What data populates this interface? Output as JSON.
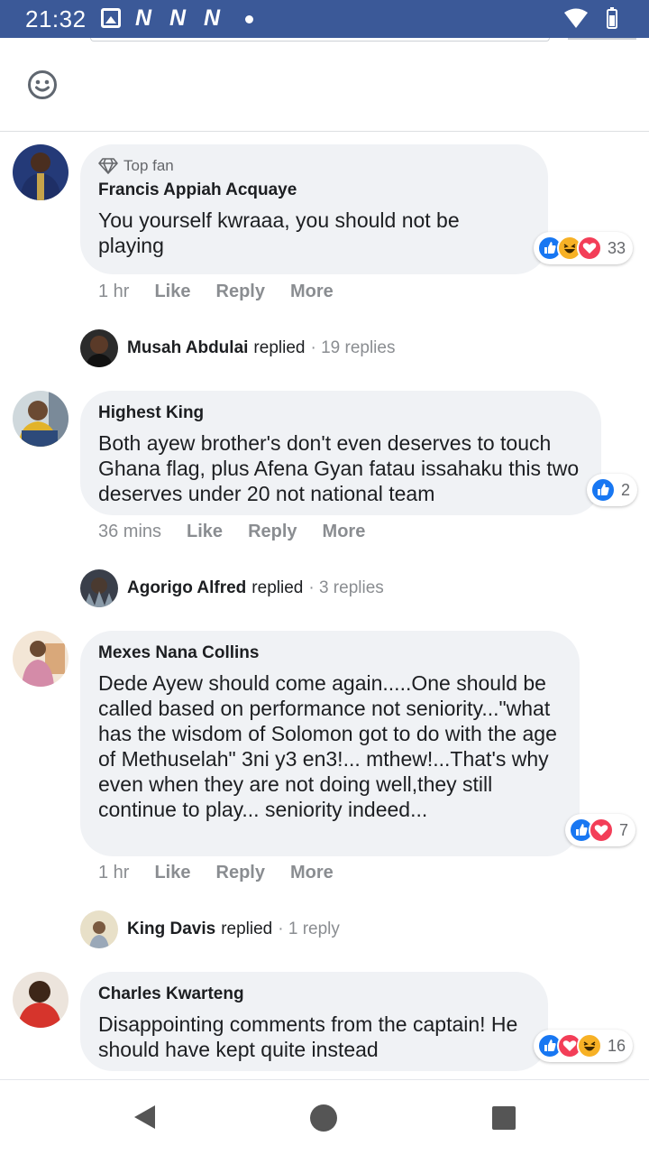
{
  "status_bar": {
    "time": "21:32",
    "icons": [
      "image-icon",
      "n-notification-icon",
      "n-notification-icon",
      "n-notification-icon",
      "dot-icon",
      "wifi-icon",
      "battery-icon"
    ],
    "n_letter": "N",
    "background": "#3b5998"
  },
  "composer": {
    "emoji_icon": "smiley-icon"
  },
  "comments": [
    {
      "badge": "Top fan",
      "author": "Francis Appiah Acquaye",
      "text": "You yourself kwraaa, you should not be playing",
      "reactions": [
        "like",
        "haha",
        "love"
      ],
      "reaction_count": "33",
      "time": "1 hr",
      "like": "Like",
      "reply": "Reply",
      "more": "More",
      "replied": {
        "name": "Musah Abdulai",
        "verb": "replied",
        "count": "· 19 replies"
      }
    },
    {
      "badge": "",
      "author": "Highest King",
      "text": "Both ayew brother's don't even deserves to touch Ghana flag, plus Afena Gyan fatau issahaku this two deserves under 20 not national team",
      "reactions": [
        "like"
      ],
      "reaction_count": "2",
      "time": "36 mins",
      "like": "Like",
      "reply": "Reply",
      "more": "More",
      "replied": {
        "name": "Agorigo Alfred",
        "verb": "replied",
        "count": "· 3 replies"
      }
    },
    {
      "badge": "",
      "author": "Mexes Nana Collins",
      "text": "Dede Ayew should come again.....One should be called based on performance not seniority...\"what has the wisdom of Solomon got to do with the age of Methuselah\" 3ni y3 en3!... mthew!...That's why even when they are not doing well,they still continue to play... seniority indeed...",
      "reactions": [
        "like",
        "love"
      ],
      "reaction_count": "7",
      "time": "1 hr",
      "like": "Like",
      "reply": "Reply",
      "more": "More",
      "replied": {
        "name": "King Davis",
        "verb": "replied",
        "count": "· 1 reply"
      }
    },
    {
      "badge": "",
      "author": "Charles Kwarteng",
      "text": "Disappointing comments from the captain! He should have kept quite instead",
      "reactions": [
        "like",
        "love",
        "haha"
      ],
      "reaction_count": "16"
    }
  ],
  "nav_bar": {
    "back_icon": "back-triangle-icon",
    "home_icon": "home-circle-icon",
    "recents_icon": "recents-square-icon"
  }
}
